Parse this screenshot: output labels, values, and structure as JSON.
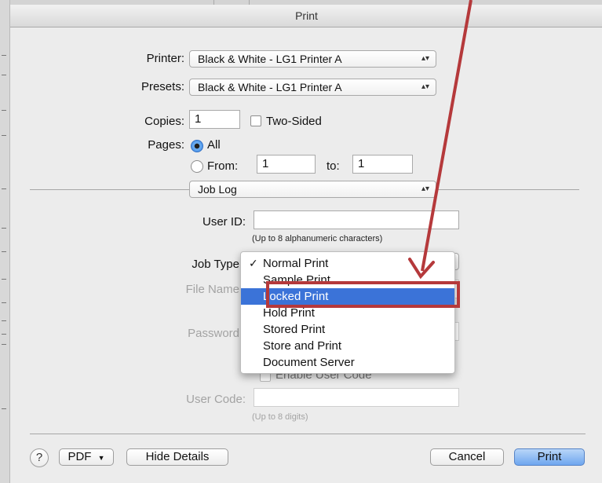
{
  "window": {
    "title": "Print"
  },
  "printer": {
    "label": "Printer:",
    "value": "Black & White - LG1 Printer A"
  },
  "presets": {
    "label": "Presets:",
    "value": "Black & White - LG1 Printer A"
  },
  "copies": {
    "label": "Copies:",
    "value": "1",
    "two_sided_label": "Two-Sided",
    "two_sided_checked": false
  },
  "pages": {
    "label": "Pages:",
    "all_label": "All",
    "all_selected": true,
    "from_label": "From:",
    "from_value": "1",
    "to_label": "to:",
    "to_value": "1"
  },
  "section_popup": {
    "value": "Job Log"
  },
  "user_id": {
    "label": "User ID:",
    "value": "",
    "hint": "(Up to 8 alphanumeric characters)"
  },
  "job_type": {
    "label": "Job Type",
    "menu_items": [
      {
        "label": "Normal Print",
        "checked": true
      },
      {
        "label": "Sample Print"
      },
      {
        "label": "Locked Print",
        "highlighted": true
      },
      {
        "label": "Hold Print"
      },
      {
        "label": "Stored Print"
      },
      {
        "label": "Store and Print"
      },
      {
        "label": "Document Server"
      }
    ]
  },
  "file_name": {
    "label": "File Name"
  },
  "password": {
    "label": "Password"
  },
  "enable_user_code": {
    "label": "Enable User Code"
  },
  "user_code": {
    "label": "User Code:",
    "value": "",
    "hint": "(Up to 8 digits)"
  },
  "footer": {
    "help_label": "?",
    "pdf_label": "PDF",
    "hide_details_label": "Hide Details",
    "cancel_label": "Cancel",
    "print_label": "Print"
  },
  "annotation": {
    "color": "#b5393b"
  }
}
